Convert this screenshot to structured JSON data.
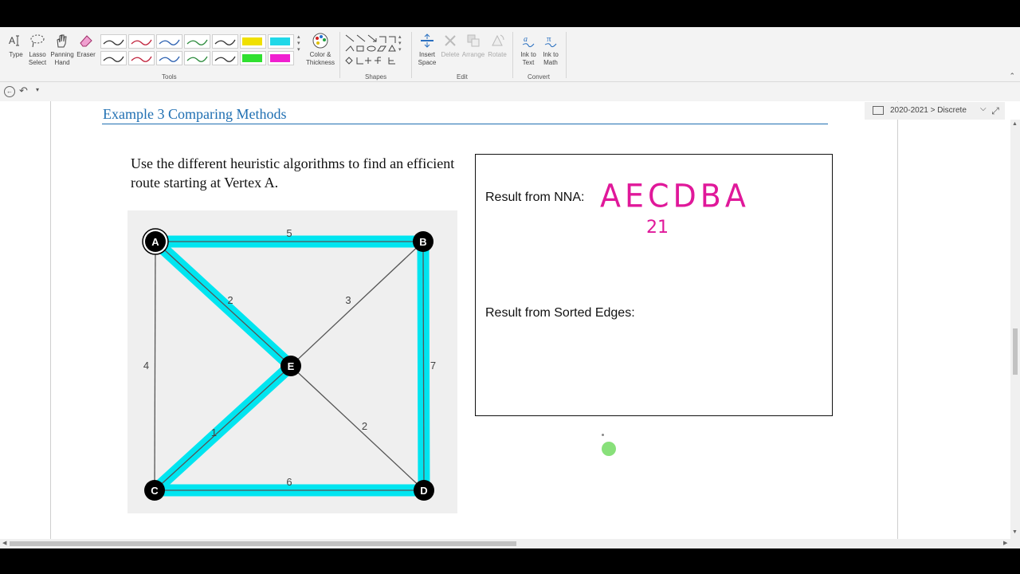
{
  "ribbon": {
    "tools": [
      {
        "name": "type",
        "label": "Type"
      },
      {
        "name": "lasso-select",
        "label": "Lasso Select"
      },
      {
        "name": "panning-hand",
        "label": "Panning Hand"
      },
      {
        "name": "eraser",
        "label": "Eraser"
      }
    ],
    "color_thickness_label": "Color & Thickness",
    "groups": {
      "tools": "Tools",
      "shapes": "Shapes",
      "edit": "Edit",
      "convert": "Convert"
    },
    "edit": [
      {
        "name": "insert-space",
        "label": "Insert Space",
        "enabled": true
      },
      {
        "name": "delete",
        "label": "Delete",
        "enabled": false
      },
      {
        "name": "arrange",
        "label": "Arrange",
        "enabled": false
      },
      {
        "name": "rotate",
        "label": "Rotate",
        "enabled": false
      }
    ],
    "convert": [
      {
        "name": "ink-to-text",
        "label": "Ink to Text"
      },
      {
        "name": "ink-to-math",
        "label": "Ink to Math"
      }
    ],
    "pen_colors": [
      "#333333",
      "#c0203a",
      "#2a5fb0",
      "#2a8a3a",
      "#333333",
      "#f0e000",
      "#20d8e8",
      "#333333",
      "#c0203a",
      "#2a5fb0",
      "#2a8a3a",
      "#333333",
      "#30e030",
      "#f020d0"
    ]
  },
  "notebook": {
    "label": "2020-2021 > Discrete"
  },
  "page": {
    "title": "Example 3 Comparing Methods",
    "instructions": "Use the different heuristic algorithms to find an efficient route starting at Vertex A.",
    "result_nna_label": "Result from NNA:",
    "result_sorted_label": "Result from Sorted Edges:",
    "handwritten_route": "AECDBA",
    "handwritten_total": "21"
  },
  "graph": {
    "vertices": [
      "A",
      "B",
      "C",
      "D",
      "E"
    ],
    "edges": [
      {
        "from": "A",
        "to": "B",
        "weight": "5",
        "highlighted": true
      },
      {
        "from": "A",
        "to": "C",
        "weight": "4",
        "highlighted": false
      },
      {
        "from": "A",
        "to": "E",
        "weight": "2",
        "highlighted": true
      },
      {
        "from": "B",
        "to": "E",
        "weight": "3",
        "highlighted": false
      },
      {
        "from": "B",
        "to": "D",
        "weight": "7",
        "highlighted": true
      },
      {
        "from": "C",
        "to": "E",
        "weight": "1",
        "highlighted": true
      },
      {
        "from": "E",
        "to": "D",
        "weight": "2",
        "highlighted": false
      },
      {
        "from": "C",
        "to": "D",
        "weight": "6",
        "highlighted": true
      }
    ]
  },
  "colors": {
    "highlight": "#00e5f0",
    "handwriting": "#e0189a",
    "title": "#1f6fb2",
    "cursor": "#88e07a"
  }
}
